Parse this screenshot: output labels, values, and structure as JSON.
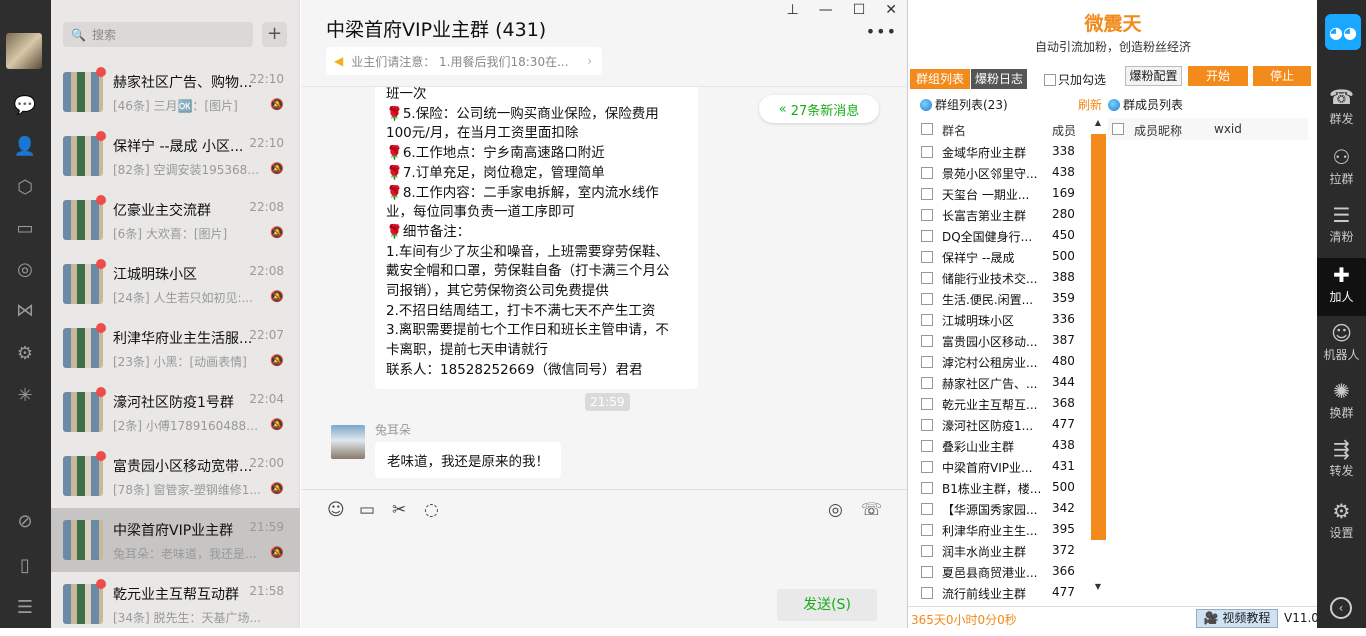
{
  "search": {
    "placeholder": "搜索"
  },
  "chats": [
    {
      "name": "赫家社区广告、购物...",
      "time": "22:10",
      "msg": "[46条] 三月🆗：[图片]"
    },
    {
      "name": "保祥宁 --晟成 小区...",
      "time": "22:10",
      "msg": "[82条] 空调安装1953688..."
    },
    {
      "name": "亿豪业主交流群",
      "time": "22:08",
      "msg": "[6条] 大欢喜：[图片]"
    },
    {
      "name": "江城明珠小区",
      "time": "22:08",
      "msg": "[24条] 人生若只如初见:..."
    },
    {
      "name": "利津华府业主生活服...",
      "time": "22:07",
      "msg": "[23条] 小黑：[动画表情]"
    },
    {
      "name": "濠河社区防疫1号群",
      "time": "22:04",
      "msg": "[2条] 小傅17891604882..."
    },
    {
      "name": "富贵园小区移动宽带...",
      "time": "22:00",
      "msg": "[78条] 窗管家-塑钢维修1..."
    },
    {
      "name": "中梁首府VIP业主群",
      "time": "21:59",
      "msg": "兔耳朵：老味道，我还是..."
    },
    {
      "name": "乾元业主互帮互动群",
      "time": "21:58",
      "msg": "[34条] 脱先生：天基广场..."
    }
  ],
  "chat": {
    "title": "中梁首府VIP业主群 (431)",
    "notice": "业主们请注意： 1.用餐后我们18:30在...",
    "new_messages": "27条新消息",
    "message_lines": [
      "班一次",
      "🌹5.保险：公司统一购买商业保险，保险费用",
      "100元/月，在当月工资里面扣除",
      "🌹6.工作地点：宁乡南高速路口附近",
      "🌹7.订单充足，岗位稳定，管理简单",
      "🌹8.工作内容：二手家电拆解，室内流水线作",
      "业，每位同事负责一道工序即可",
      "🌹细节备注：",
      "1.车间有少了灰尘和噪音，上班需要穿劳保鞋、",
      "戴安全帽和口罩，劳保鞋自备（打卡满三个月公",
      "司报销），其它劳保物资公司免费提供",
      "2.不招日结周结工，打卡不满七天不产生工资",
      "3.离职需要提前七个工作日和班长主管申请，不",
      "卡离职，提前七天申请就行",
      "联系人：18528252669（微信同号）君君"
    ],
    "timestamp": "21:59",
    "sender": "兔耳朵",
    "last_message": "老味道，我还是原来的我！",
    "send_label": "发送(S)"
  },
  "panel": {
    "brand": "微震天",
    "slogan": "自动引流加粉，创造粉丝经济",
    "tab_groups": "群组列表",
    "tab_log": "爆粉日志",
    "only_checked": "只加勾选",
    "config_label": "爆粉配置",
    "start_label": "开始",
    "stop_label": "停止",
    "group_list_label": "群组列表(23)",
    "refresh_label": "刷新",
    "member_list_label": "群成员列表",
    "col_group": "群名",
    "col_members": "成员",
    "col_nickname": "成员昵称",
    "col_wxid": "wxid",
    "groups": [
      {
        "name": "金域华府业主群",
        "count": "338"
      },
      {
        "name": "景苑小区邻里守...",
        "count": "438"
      },
      {
        "name": "天玺台 一期业...",
        "count": "169"
      },
      {
        "name": "长富吉第业主群",
        "count": "280"
      },
      {
        "name": "DQ全国健身行...",
        "count": "450"
      },
      {
        "name": "保祥宁 --晟成",
        "count": "500"
      },
      {
        "name": "储能行业技术交...",
        "count": "388"
      },
      {
        "name": "生活.便民.闲置...",
        "count": "359"
      },
      {
        "name": "江城明珠小区",
        "count": "336"
      },
      {
        "name": "富贵园小区移动...",
        "count": "387"
      },
      {
        "name": "滹沱村公租房业...",
        "count": "480"
      },
      {
        "name": "赫家社区广告、...",
        "count": "344"
      },
      {
        "name": "乾元业主互帮互...",
        "count": "368"
      },
      {
        "name": "濠河社区防疫1...",
        "count": "477"
      },
      {
        "name": "叠彩山业主群",
        "count": "438"
      },
      {
        "name": "中梁首府VIP业...",
        "count": "431"
      },
      {
        "name": "B1栋业主群，楼...",
        "count": "500"
      },
      {
        "name": "【华源国秀家园...",
        "count": "342"
      },
      {
        "name": "利津华府业主生...",
        "count": "395"
      },
      {
        "name": "润丰水尚业主群",
        "count": "372"
      },
      {
        "name": "夏邑县商贸港业...",
        "count": "366"
      },
      {
        "name": "流行前线业主群",
        "count": "477"
      }
    ],
    "timer": "365天0小时0分0秒",
    "video_tutorial": "视频教程",
    "version": "V11.0"
  },
  "sidebar": {
    "items": [
      {
        "label": "群发",
        "icon": "☎"
      },
      {
        "label": "拉群",
        "icon": "⚇"
      },
      {
        "label": "清粉",
        "icon": "☰"
      },
      {
        "label": "加人",
        "icon": "✚"
      },
      {
        "label": "机器人",
        "icon": "☺"
      },
      {
        "label": "换群",
        "icon": "✺"
      },
      {
        "label": "转发",
        "icon": "⇶"
      },
      {
        "label": "设置",
        "icon": "⚙"
      }
    ]
  }
}
